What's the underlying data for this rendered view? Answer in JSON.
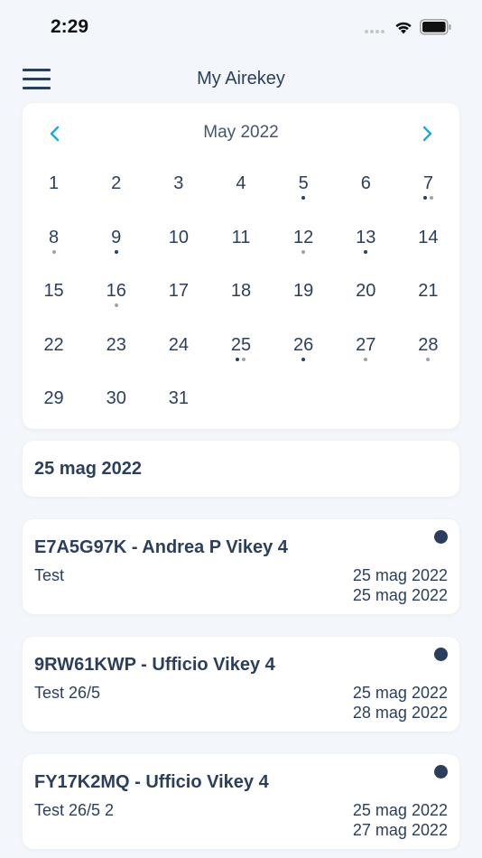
{
  "status_bar": {
    "time": "2:29",
    "icons": [
      "signal-dots",
      "wifi-icon",
      "battery-icon"
    ]
  },
  "nav": {
    "title": "My Airekey",
    "menu_icon": "hamburger-menu-icon"
  },
  "calendar": {
    "month_label": "May 2022",
    "prev_icon": "chevron-left-icon",
    "next_icon": "chevron-right-icon",
    "accent_color": "#1aa7e0",
    "weeks": [
      [
        {
          "day": "1",
          "dots": []
        },
        {
          "day": "2",
          "dots": []
        },
        {
          "day": "3",
          "dots": []
        },
        {
          "day": "4",
          "dots": []
        },
        {
          "day": "5",
          "dots": [
            "dark"
          ]
        },
        {
          "day": "6",
          "dots": []
        },
        {
          "day": "7",
          "dots": [
            "dark",
            "grey"
          ]
        }
      ],
      [
        {
          "day": "8",
          "dots": [
            "grey"
          ]
        },
        {
          "day": "9",
          "dots": [
            "dark"
          ]
        },
        {
          "day": "10",
          "dots": []
        },
        {
          "day": "11",
          "dots": []
        },
        {
          "day": "12",
          "dots": [
            "grey"
          ]
        },
        {
          "day": "13",
          "dots": [
            "dark"
          ]
        },
        {
          "day": "14",
          "dots": []
        }
      ],
      [
        {
          "day": "15",
          "dots": []
        },
        {
          "day": "16",
          "dots": [
            "grey"
          ]
        },
        {
          "day": "17",
          "dots": []
        },
        {
          "day": "18",
          "dots": []
        },
        {
          "day": "19",
          "dots": []
        },
        {
          "day": "20",
          "dots": []
        },
        {
          "day": "21",
          "dots": []
        }
      ],
      [
        {
          "day": "22",
          "dots": []
        },
        {
          "day": "23",
          "dots": []
        },
        {
          "day": "24",
          "dots": []
        },
        {
          "day": "25",
          "dots": [
            "dark",
            "grey"
          ]
        },
        {
          "day": "26",
          "dots": [
            "dark"
          ]
        },
        {
          "day": "27",
          "dots": [
            "grey"
          ]
        },
        {
          "day": "28",
          "dots": [
            "grey"
          ]
        }
      ],
      [
        {
          "day": "29",
          "dots": []
        },
        {
          "day": "30",
          "dots": []
        },
        {
          "day": "31",
          "dots": []
        },
        {
          "day": "",
          "dots": []
        },
        {
          "day": "",
          "dots": []
        },
        {
          "day": "",
          "dots": []
        },
        {
          "day": "",
          "dots": []
        }
      ]
    ]
  },
  "selected_date": {
    "label": "25 mag 2022"
  },
  "keys": [
    {
      "title": "E7A5G97K - Andrea P Vikey 4",
      "description": "Test",
      "start": "25 mag 2022",
      "end": "25 mag 2022"
    },
    {
      "title": "9RW61KWP - Ufficio Vikey 4",
      "description": "Test 26/5",
      "start": "25 mag 2022",
      "end": "28 mag 2022"
    },
    {
      "title": "FY17K2MQ - Ufficio Vikey 4",
      "description": "Test 26/5 2",
      "start": "25 mag 2022",
      "end": "27 mag 2022"
    }
  ],
  "colors": {
    "primary_text": "#2b3f5c",
    "background": "#f3f6fa",
    "card": "#ffffff",
    "dot_grey": "#9ba3ad"
  }
}
